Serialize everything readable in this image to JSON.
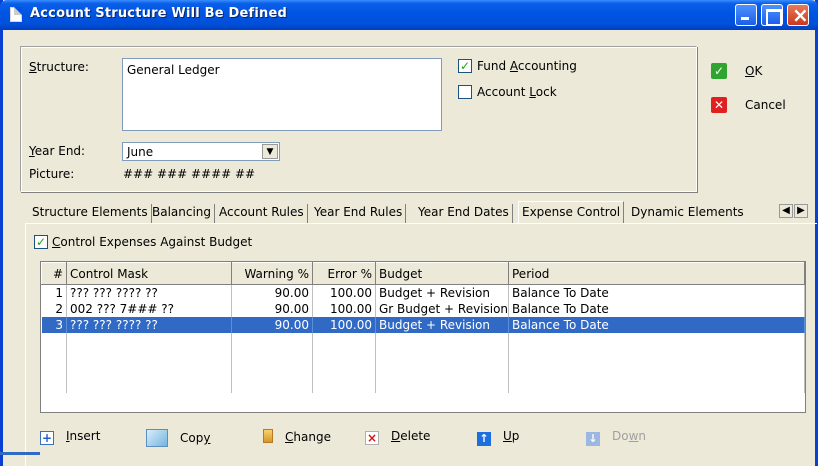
{
  "window": {
    "title": "Account Structure Will Be Defined"
  },
  "form": {
    "structure_label_prefix": "S",
    "structure_label_rest": "tructure:",
    "structure_value": "General Ledger",
    "year_end_label_prefix": "Y",
    "year_end_label_rest": "ear End:",
    "year_end_value": "June",
    "picture_label": "Picture:",
    "picture_value": "### ### #### ##",
    "fund_accounting_label_pre": "Fund ",
    "fund_accounting_label_u": "A",
    "fund_accounting_label_post": "ccounting",
    "fund_accounting_checked": true,
    "account_lock_label_pre": "Account ",
    "account_lock_label_u": "L",
    "account_lock_label_post": "ock",
    "account_lock_checked": false
  },
  "actions": {
    "ok_u": "O",
    "ok_rest": "K",
    "cancel_label": "Cancel"
  },
  "tabs": [
    "Structure Elements",
    "Balancing",
    "Account Rules",
    "Year End Rules",
    "Year End Dates",
    "Expense Control",
    "Dynamic Elements"
  ],
  "active_tab": "Expense Control",
  "expense_control": {
    "checkbox_u": "C",
    "checkbox_rest": "ontrol Expenses Against Budget",
    "checked": true,
    "columns": [
      "#",
      "Control Mask",
      "Warning %",
      "Error %",
      "Budget",
      "Period"
    ],
    "rows": [
      {
        "n": "1",
        "mask": "??? ??? ???? ??",
        "warning": "90.00",
        "error": "100.00",
        "budget": "Budget + Revision",
        "period": "Balance To Date"
      },
      {
        "n": "2",
        "mask": "002 ??? 7### ??",
        "warning": "90.00",
        "error": "100.00",
        "budget": "Gr Budget + Revision",
        "period": "Balance To Date"
      },
      {
        "n": "3",
        "mask": "??? ??? ???? ??",
        "warning": "90.00",
        "error": "100.00",
        "budget": "Budget + Revision",
        "period": "Balance To Date"
      }
    ],
    "selected_row": 3
  },
  "toolbar": {
    "insert_u": "I",
    "insert_rest": "nsert",
    "copy_pre": "Cop",
    "copy_u": "y",
    "change_u": "C",
    "change_rest": "hange",
    "delete_u": "D",
    "delete_rest": "elete",
    "up_u": "U",
    "up_rest": "p",
    "down_pre": "Do",
    "down_u": "w",
    "down_post": "n"
  },
  "colors": {
    "selection": "#316ac5",
    "titlebar": "#0054e3",
    "face": "#ece9d8"
  }
}
